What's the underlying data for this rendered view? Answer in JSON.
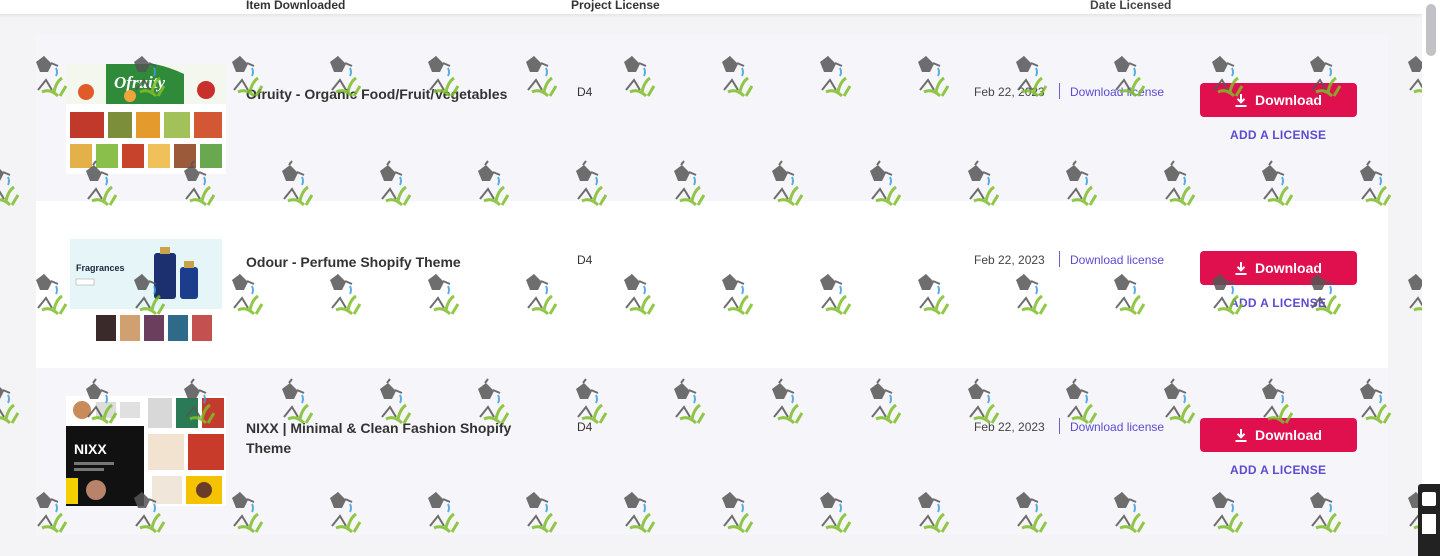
{
  "table": {
    "headers": {
      "item": "Item Downloaded",
      "license": "Project License",
      "date": "Date Licensed"
    },
    "rows": [
      {
        "title": "Ofruity - Organic Food/Fruit/Vegetables",
        "thumb_text": "Ofruity",
        "license": "D4",
        "date": "Feb 22, 2023",
        "download_license": "Download license",
        "download_button": "Download",
        "add_license": "ADD A LICENSE"
      },
      {
        "title": "Odour - Perfume Shopify Theme",
        "thumb_text": "Fragrances",
        "license": "D4",
        "date": "Feb 22, 2023",
        "download_license": "Download license",
        "download_button": "Download",
        "add_license": "ADD A LICENSE"
      },
      {
        "title": "NIXX | Minimal & Clean Fashion Shopify Theme",
        "thumb_text": "NIXX",
        "license": "D4",
        "date": "Feb 22, 2023",
        "download_license": "Download license",
        "download_button": "Download",
        "add_license": "ADD A LICENSE"
      }
    ]
  },
  "colors": {
    "accent": "#e0104f",
    "link": "#5b4bd2",
    "row_alt": "#f6f6fa"
  },
  "icons": [
    "download-icon",
    "watering-can-watermark"
  ]
}
